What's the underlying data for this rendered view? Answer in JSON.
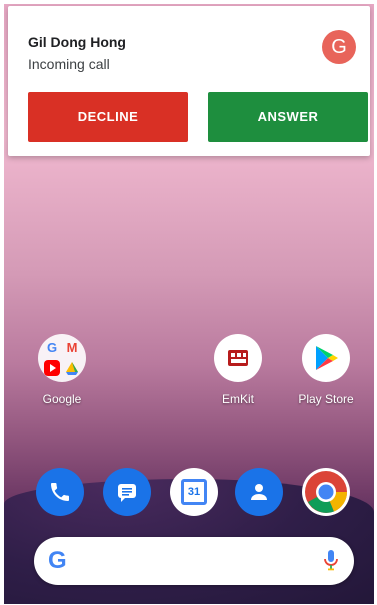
{
  "notification": {
    "caller_name": "Gil Dong Hong",
    "status": "Incoming call",
    "avatar_letter": "G",
    "decline_label": "DECLINE",
    "answer_label": "ANSWER",
    "colors": {
      "decline": "#d93025",
      "answer": "#1e8e3e",
      "avatar": "#e8645a"
    }
  },
  "home": {
    "apps": [
      {
        "label": "Google",
        "icon": "google-folder-icon"
      },
      {
        "label": "EmKit",
        "icon": "emkit-icon"
      },
      {
        "label": "Play Store",
        "icon": "play-store-icon"
      }
    ],
    "dock": [
      {
        "icon": "phone-icon"
      },
      {
        "icon": "messages-icon"
      },
      {
        "icon": "calendar-icon",
        "text": "31"
      },
      {
        "icon": "contacts-icon"
      },
      {
        "icon": "chrome-icon"
      }
    ],
    "search": {
      "logo": "G",
      "icon": "mic-icon"
    }
  }
}
